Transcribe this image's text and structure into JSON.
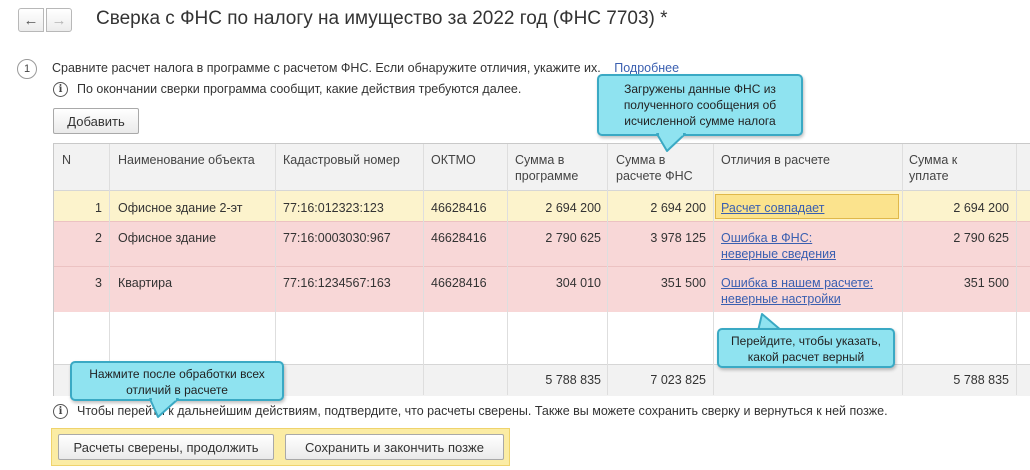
{
  "header": {
    "title": "Сверка с ФНС по налогу на имущество за 2022 год (ФНС 7703) *",
    "back_icon": "arrow-left-icon",
    "forward_icon": "arrow-right-icon"
  },
  "step": {
    "number": "1",
    "text": "Сравните расчет налога в программе с расчетом ФНС. Если обнаружите отличия, укажите их.",
    "more_link": "Подробнее",
    "info_text": "По окончании сверки программа сообщит, какие действия требуются далее."
  },
  "toolbar": {
    "add_label": "Добавить"
  },
  "table": {
    "columns": {
      "n": "N",
      "name": "Наименование объекта",
      "cadastral": "Кадастровый номер",
      "oktmo": "ОКТМО",
      "sum_program": "Сумма в программе",
      "sum_fns": "Сумма в расчете ФНС",
      "diff": "Отличия в расчете",
      "sum_pay": "Сумма к уплате"
    },
    "rows": [
      {
        "n": "1",
        "name": "Офисное здание 2-эт",
        "cadastral": "77:16:012323:123",
        "oktmo": "46628416",
        "sum_program": "2 694 200",
        "sum_fns": "2 694 200",
        "diff_1": "Расчет совпадает",
        "diff_2": "",
        "sum_pay": "2 694 200"
      },
      {
        "n": "2",
        "name": "Офисное здание",
        "cadastral": "77:16:0003030:967",
        "oktmo": "46628416",
        "sum_program": "2 790 625",
        "sum_fns": "3 978 125",
        "diff_1": "Ошибка в ФНС:",
        "diff_2": "неверные сведения",
        "sum_pay": "2 790 625"
      },
      {
        "n": "3",
        "name": "Квартира",
        "cadastral": "77:16:1234567:163",
        "oktmo": "46628416",
        "sum_program": "304 010",
        "sum_fns": "351 500",
        "diff_1": "Ошибка в нашем расчете:",
        "diff_2": "неверные настройки",
        "sum_pay": "351 500"
      }
    ],
    "totals": {
      "sum_program": "5 788 835",
      "sum_fns": "7 023 825",
      "sum_pay": "5 788 835"
    }
  },
  "callouts": {
    "fns_data": "Загружены данные ФНС из полученного сообщения об исчисленной сумме налога",
    "choose": "Перейдите, чтобы указать, какой расчет верный",
    "press": "Нажмите после обработки всех отличий в расчете"
  },
  "bottom": {
    "info_text": "Чтобы перейти к дальнейшим действиям, подтвердите, что расчеты сверены. Также вы можете сохранить сверку и вернуться к ней позже.",
    "confirm_label": "Расчеты сверены, продолжить",
    "save_label": "Сохранить и закончить позже"
  },
  "colors": {
    "row_selected": "#fcf3cc",
    "row_error": "#f8d7d7",
    "callout_bg": "#8fe3f0",
    "link": "#3a5fb0",
    "highlight_box": "#fbeca4"
  }
}
